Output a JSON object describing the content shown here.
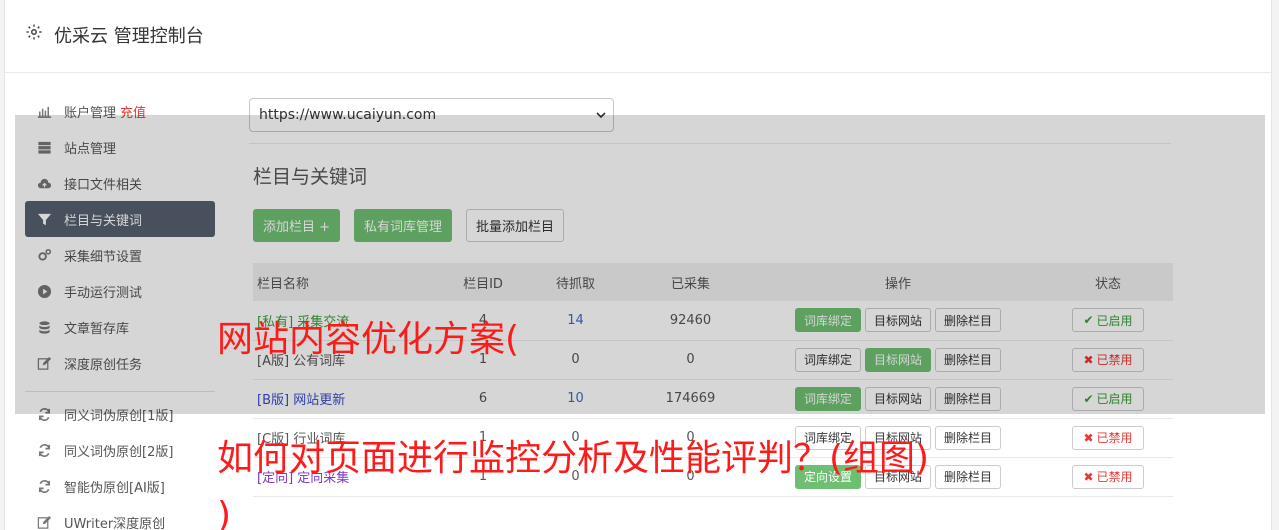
{
  "header": {
    "title": "优采云 管理控制台"
  },
  "sidebar": {
    "items": [
      {
        "label": "账户管理",
        "extra": "充值",
        "icon": "bar-chart-icon"
      },
      {
        "label": "站点管理",
        "icon": "server-icon"
      },
      {
        "label": "接口文件相关",
        "icon": "cloud-upload-icon"
      },
      {
        "label": "栏目与关键词",
        "icon": "filter-icon",
        "active": true
      },
      {
        "label": "采集细节设置",
        "icon": "cogs-icon"
      },
      {
        "label": "手动运行测试",
        "icon": "play-circle-icon"
      },
      {
        "label": "文章暂存库",
        "icon": "database-icon"
      },
      {
        "label": "深度原创任务",
        "icon": "edit-icon"
      }
    ],
    "items2": [
      {
        "label": "同义词伪原创[1版]",
        "icon": "refresh-icon"
      },
      {
        "label": "同义词伪原创[2版]",
        "icon": "refresh-icon"
      },
      {
        "label": "智能伪原创[AI版]",
        "icon": "refresh-icon"
      },
      {
        "label": "UWriter深度原创",
        "icon": "edit-icon"
      }
    ]
  },
  "main": {
    "site_select": "https://www.ucaiyun.com",
    "section_title": "栏目与关键词",
    "buttons": {
      "add": "添加栏目 +",
      "private_lib": "私有词库管理",
      "batch_add": "批量添加栏目"
    },
    "table": {
      "headers": [
        "栏目名称",
        "栏目ID",
        "待抓取",
        "已采集",
        "操作",
        "状态"
      ],
      "op_labels": {
        "bind": "词库绑定",
        "target": "目标网站",
        "delete": "删除栏目",
        "direct": "定向设置"
      },
      "status_labels": {
        "on": "已启用",
        "off": "已禁用"
      },
      "rows": [
        {
          "name": "[私有] 采集交流",
          "id": "4",
          "pending": "14",
          "collected": "92460",
          "status": "on",
          "first_op": "bind",
          "first_green": true,
          "second_green": false,
          "color": "green"
        },
        {
          "name": "[A版] 公有词库",
          "id": "1",
          "pending": "0",
          "collected": "0",
          "status": "off",
          "first_op": "bind",
          "first_green": false,
          "second_green": true,
          "color": "normal"
        },
        {
          "name": "[B版] 网站更新",
          "id": "6",
          "pending": "10",
          "collected": "174669",
          "status": "on",
          "first_op": "bind",
          "first_green": true,
          "second_green": false,
          "color": "blue"
        },
        {
          "name": "[C版] 行业词库",
          "id": "1",
          "pending": "0",
          "collected": "0",
          "status": "off",
          "first_op": "bind",
          "first_green": false,
          "second_green": false,
          "color": "normal"
        },
        {
          "name": "[定向] 定向采集",
          "id": "1",
          "pending": "0",
          "collected": "0",
          "status": "off",
          "first_op": "direct",
          "first_green": true,
          "second_green": false,
          "color": "purple"
        }
      ]
    }
  },
  "watermark": {
    "line1": "网站内容优化方案(",
    "line2": "如何对页面进行监控分析及性能评判？(组图)",
    "line3": ")"
  }
}
